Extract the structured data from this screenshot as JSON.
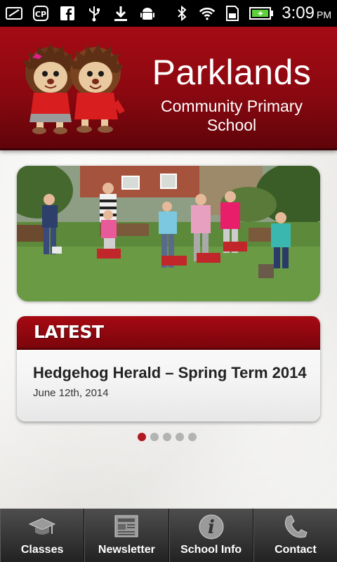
{
  "status_bar": {
    "left_icons": [
      "message-icon",
      "voicemail-icon",
      "facebook-icon",
      "usb-icon",
      "download-icon",
      "android-icon"
    ],
    "right_icons": [
      "bluetooth-icon",
      "wifi-icon",
      "sd-card-icon",
      "battery-icon"
    ],
    "time": "3:09",
    "ampm": "PM"
  },
  "header": {
    "title": "Parklands",
    "subtitle": "Community Primary School"
  },
  "latest": {
    "label": "LATEST",
    "title": "Hedgehog Herald – Spring Term 2014",
    "date": "June 12th, 2014"
  },
  "carousel": {
    "count": 5,
    "active_index": 0
  },
  "tabs": [
    {
      "label": "Classes",
      "icon": "graduation-cap-icon"
    },
    {
      "label": "Newsletter",
      "icon": "newspaper-icon"
    },
    {
      "label": "School Info",
      "icon": "info-icon"
    },
    {
      "label": "Contact",
      "icon": "phone-icon"
    }
  ],
  "colors": {
    "brand_red": "#a50b14",
    "active_dot": "#b01a22",
    "tabbar": "#3a3a3a"
  }
}
